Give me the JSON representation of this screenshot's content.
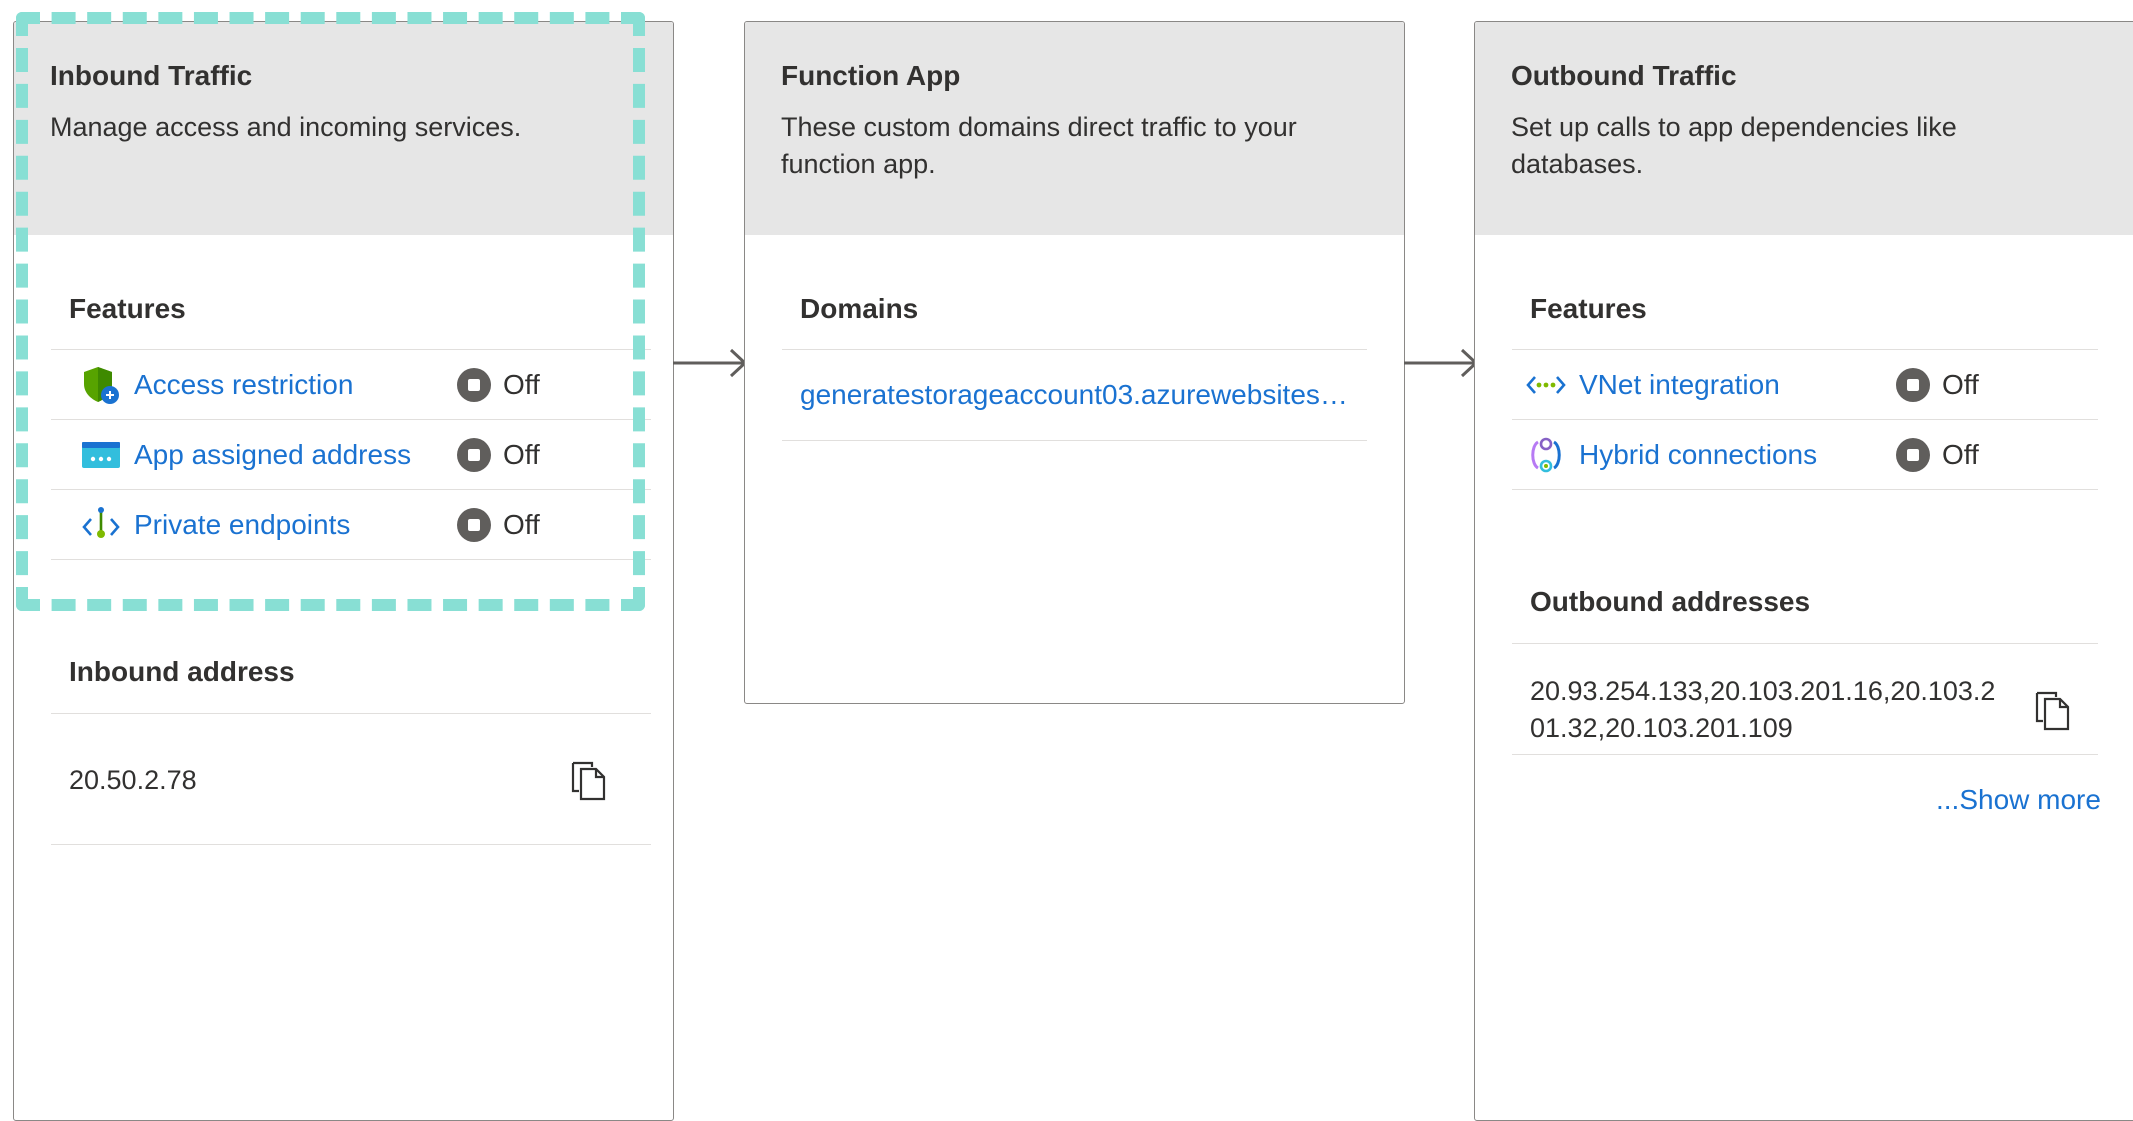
{
  "inbound": {
    "title": "Inbound Traffic",
    "description": "Manage access and incoming services.",
    "features_title": "Features",
    "features": [
      {
        "label": "Access restriction",
        "status": "Off",
        "icon": "shield-icon"
      },
      {
        "label": "App assigned address",
        "status": "Off",
        "icon": "address-icon"
      },
      {
        "label": "Private endpoints",
        "status": "Off",
        "icon": "private-endpoint-icon"
      }
    ],
    "address_title": "Inbound address",
    "address_value": "20.50.2.78"
  },
  "function_app": {
    "title": "Function App",
    "description_line1": "These custom domains direct traffic to your",
    "description_line2": "function app.",
    "domains_title": "Domains",
    "domain": "generatestorageaccount03.azurewebsites…"
  },
  "outbound": {
    "title": "Outbound Traffic",
    "description_line1": "Set up calls to app dependencies like",
    "description_line2": "databases.",
    "features_title": "Features",
    "features": [
      {
        "label": "VNet integration",
        "status": "Off",
        "icon": "vnet-icon"
      },
      {
        "label": "Hybrid connections",
        "status": "Off",
        "icon": "hybrid-connection-icon"
      }
    ],
    "addresses_title": "Outbound addresses",
    "addresses_line1": "20.93.254.133,20.103.201.16,20.103.2",
    "addresses_line2": "01.32,20.103.201.109",
    "show_more": "...Show more"
  },
  "colors": {
    "link": "#1a72d1",
    "header_bg": "#e6e6e6",
    "highlight_dash": "#88dfd4",
    "status_dot": "#605e5c"
  }
}
